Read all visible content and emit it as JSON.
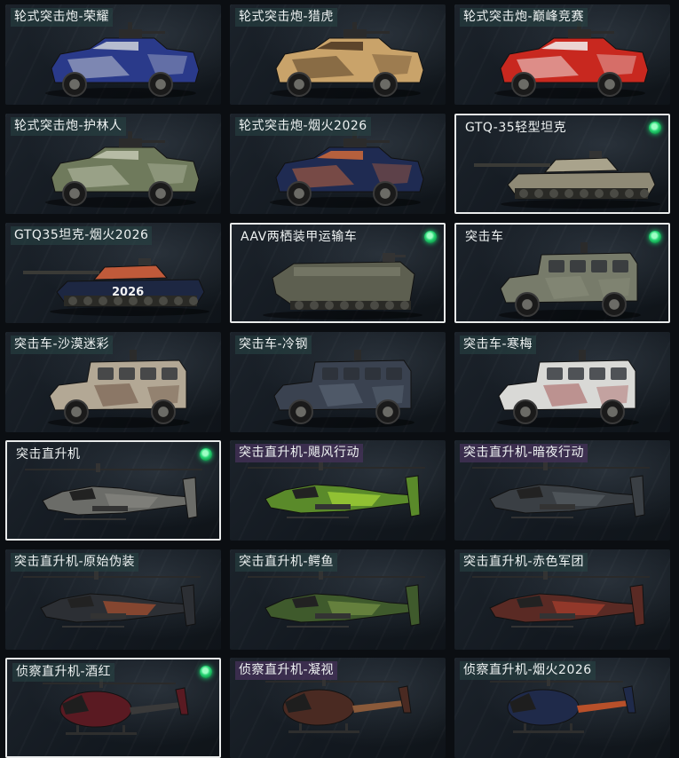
{
  "cards": [
    {
      "name": "轮式突击炮-荣耀",
      "kind": "armored-car",
      "hull": "#2a3a8a",
      "accent": "#cfd4da",
      "label_style": "teal",
      "selected": false,
      "owned": false
    },
    {
      "name": "轮式突击炮-猎虎",
      "kind": "armored-car",
      "hull": "#c9a36a",
      "accent": "#4a3520",
      "label_style": "teal",
      "selected": false,
      "owned": false
    },
    {
      "name": "轮式突击炮-巅峰竞赛",
      "kind": "armored-car",
      "hull": "#c8281f",
      "accent": "#f2f2f2",
      "label_style": "teal",
      "selected": false,
      "owned": false
    },
    {
      "name": "轮式突击炮-护林人",
      "kind": "armored-car",
      "hull": "#6f7a5c",
      "accent": "#c4c8b2",
      "label_style": "teal",
      "selected": false,
      "owned": false
    },
    {
      "name": "轮式突击炮-烟火2026",
      "kind": "armored-car",
      "hull": "#1f2b52",
      "accent": "#d06a3a",
      "label_style": "teal",
      "selected": false,
      "owned": false
    },
    {
      "name": "GTQ-35轻型坦克",
      "kind": "tank",
      "hull": "#8f8a76",
      "accent": "#a9a38c",
      "label_style": "plain",
      "selected": true,
      "owned": true
    },
    {
      "name": "GTQ35坦克-烟火2026",
      "kind": "tank",
      "hull": "#1d2742",
      "accent": "#c05a3a",
      "label_style": "teal",
      "selected": false,
      "owned": false,
      "decal": "2026"
    },
    {
      "name": "AAV两栖装甲运输车",
      "kind": "amphib",
      "hull": "#5d5f50",
      "accent": "#7d7f6c",
      "label_style": "plain",
      "selected": true,
      "owned": true
    },
    {
      "name": "突击车",
      "kind": "mrap",
      "hull": "#777b6a",
      "accent": "#8e927f",
      "label_style": "plain",
      "selected": true,
      "owned": true
    },
    {
      "name": "突击车-沙漠迷彩",
      "kind": "mrap",
      "hull": "#b3a895",
      "accent": "#5a3b2c",
      "label_style": "teal",
      "selected": false,
      "owned": false
    },
    {
      "name": "突击车-冷钢",
      "kind": "mrap",
      "hull": "#3a4250",
      "accent": "#6b7584",
      "label_style": "teal",
      "selected": false,
      "owned": false
    },
    {
      "name": "突击车-寒梅",
      "kind": "mrap",
      "hull": "#d9d9d6",
      "accent": "#9a3b3b",
      "label_style": "teal",
      "selected": false,
      "owned": false
    },
    {
      "name": "突击直升机",
      "kind": "attack-heli",
      "hull": "#6b6c68",
      "accent": "#8a8b86",
      "label_style": "plain",
      "selected": true,
      "owned": true
    },
    {
      "name": "突击直升机-飓风行动",
      "kind": "attack-heli",
      "hull": "#5a8a2a",
      "accent": "#b6e63a",
      "label_style": "purple",
      "selected": false,
      "owned": false
    },
    {
      "name": "突击直升机-暗夜行动",
      "kind": "attack-heli",
      "hull": "#3a3f44",
      "accent": "#5a6066",
      "label_style": "purple",
      "selected": false,
      "owned": false
    },
    {
      "name": "突击直升机-原始伪装",
      "kind": "attack-heli",
      "hull": "#2c2f34",
      "accent": "#c2562e",
      "label_style": "teal",
      "selected": false,
      "owned": false
    },
    {
      "name": "突击直升机-鳄鱼",
      "kind": "attack-heli",
      "hull": "#3f5a2c",
      "accent": "#7f9a4a",
      "label_style": "teal",
      "selected": false,
      "owned": false
    },
    {
      "name": "突击直升机-赤色军团",
      "kind": "attack-heli",
      "hull": "#5a2a24",
      "accent": "#b7432e",
      "label_style": "teal",
      "selected": false,
      "owned": false
    },
    {
      "name": "侦察直升机-酒红",
      "kind": "scout-heli",
      "hull": "#5a1a22",
      "accent": "#3a3a3a",
      "label_style": "teal",
      "selected": true,
      "owned": true
    },
    {
      "name": "侦察直升机-凝视",
      "kind": "scout-heli",
      "hull": "#4a2a22",
      "accent": "#8a5a3a",
      "label_style": "purple",
      "selected": false,
      "owned": false
    },
    {
      "name": "侦察直升机-烟火2026",
      "kind": "scout-heli",
      "hull": "#1f2a4a",
      "accent": "#b8502a",
      "label_style": "teal",
      "selected": false,
      "owned": false
    }
  ]
}
